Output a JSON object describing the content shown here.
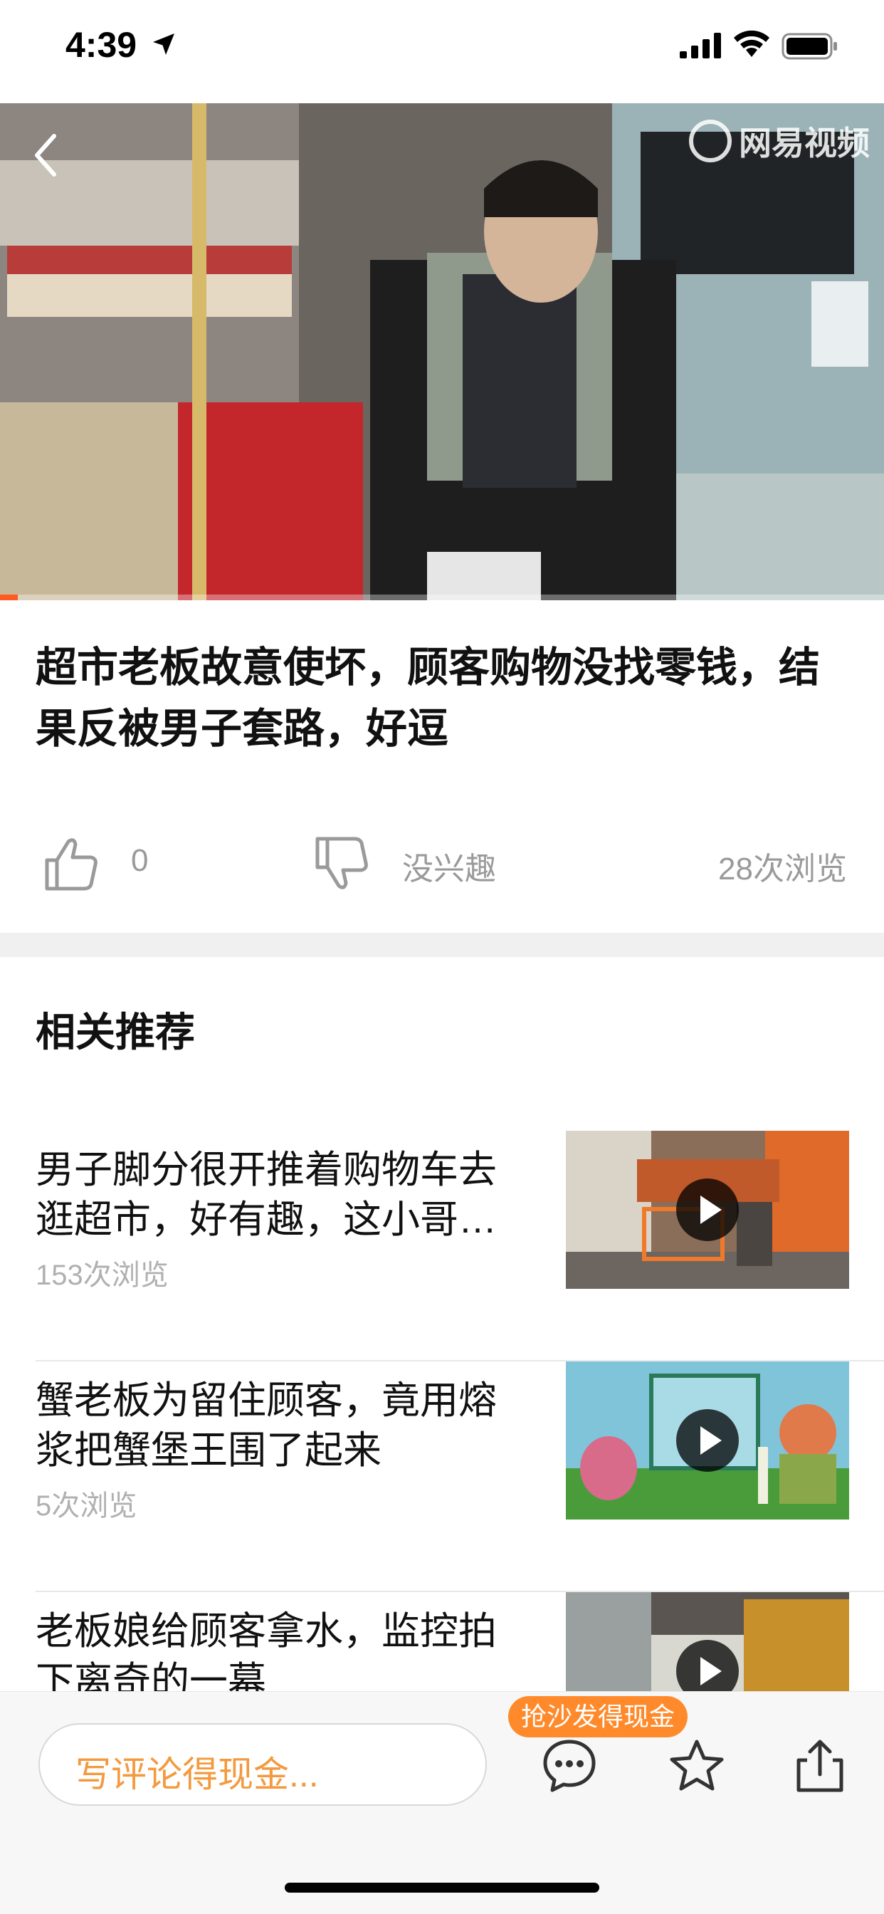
{
  "status_bar": {
    "time": "4:39"
  },
  "video": {
    "watermark": "网易视频",
    "progress": 0.02
  },
  "article": {
    "title": "超市老板故意使坏，顾客购物没找零钱，结果反被男子套路，好逗",
    "like_count": "0",
    "dislike_label": "没兴趣",
    "view_count": "28次浏览"
  },
  "related": {
    "heading": "相关推荐",
    "items": [
      {
        "title": "男子脚分很开推着购物车去逛超市，好有趣，这小哥…",
        "views": "153次浏览"
      },
      {
        "title": "蟹老板为留住顾客，竟用熔浆把蟹堡王围了起来",
        "views": "5次浏览"
      },
      {
        "title": "老板娘给顾客拿水，监控拍下离奇的一幕",
        "views": ""
      }
    ]
  },
  "bottom_bar": {
    "comment_placeholder": "写评论得现金...",
    "promo_badge": "抢沙发得现金"
  },
  "colors": {
    "accent": "#ff8a2b",
    "progress": "#ff5a1f",
    "muted": "#9a9a9a"
  }
}
